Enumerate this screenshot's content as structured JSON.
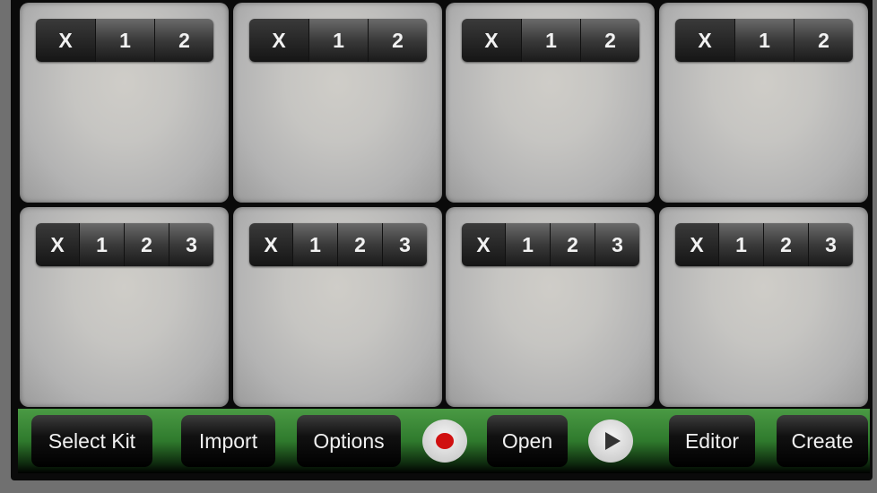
{
  "pads_top": [
    [
      "X",
      "1",
      "2"
    ],
    [
      "X",
      "1",
      "2"
    ],
    [
      "X",
      "1",
      "2"
    ],
    [
      "X",
      "1",
      "2"
    ]
  ],
  "pads_bottom": [
    [
      "X",
      "1",
      "2",
      "3"
    ],
    [
      "X",
      "1",
      "2",
      "3"
    ],
    [
      "X",
      "1",
      "2",
      "3"
    ],
    [
      "X",
      "1",
      "2",
      "3"
    ]
  ],
  "toolbar": {
    "select_kit": "Select Kit",
    "import": "Import",
    "options": "Options",
    "record_icon": "record-icon",
    "open": "Open",
    "play_icon": "play-icon",
    "editor": "Editor",
    "create": "Create"
  },
  "colors": {
    "toolbar_green": "#2f7a2d",
    "record_red": "#d01010"
  }
}
